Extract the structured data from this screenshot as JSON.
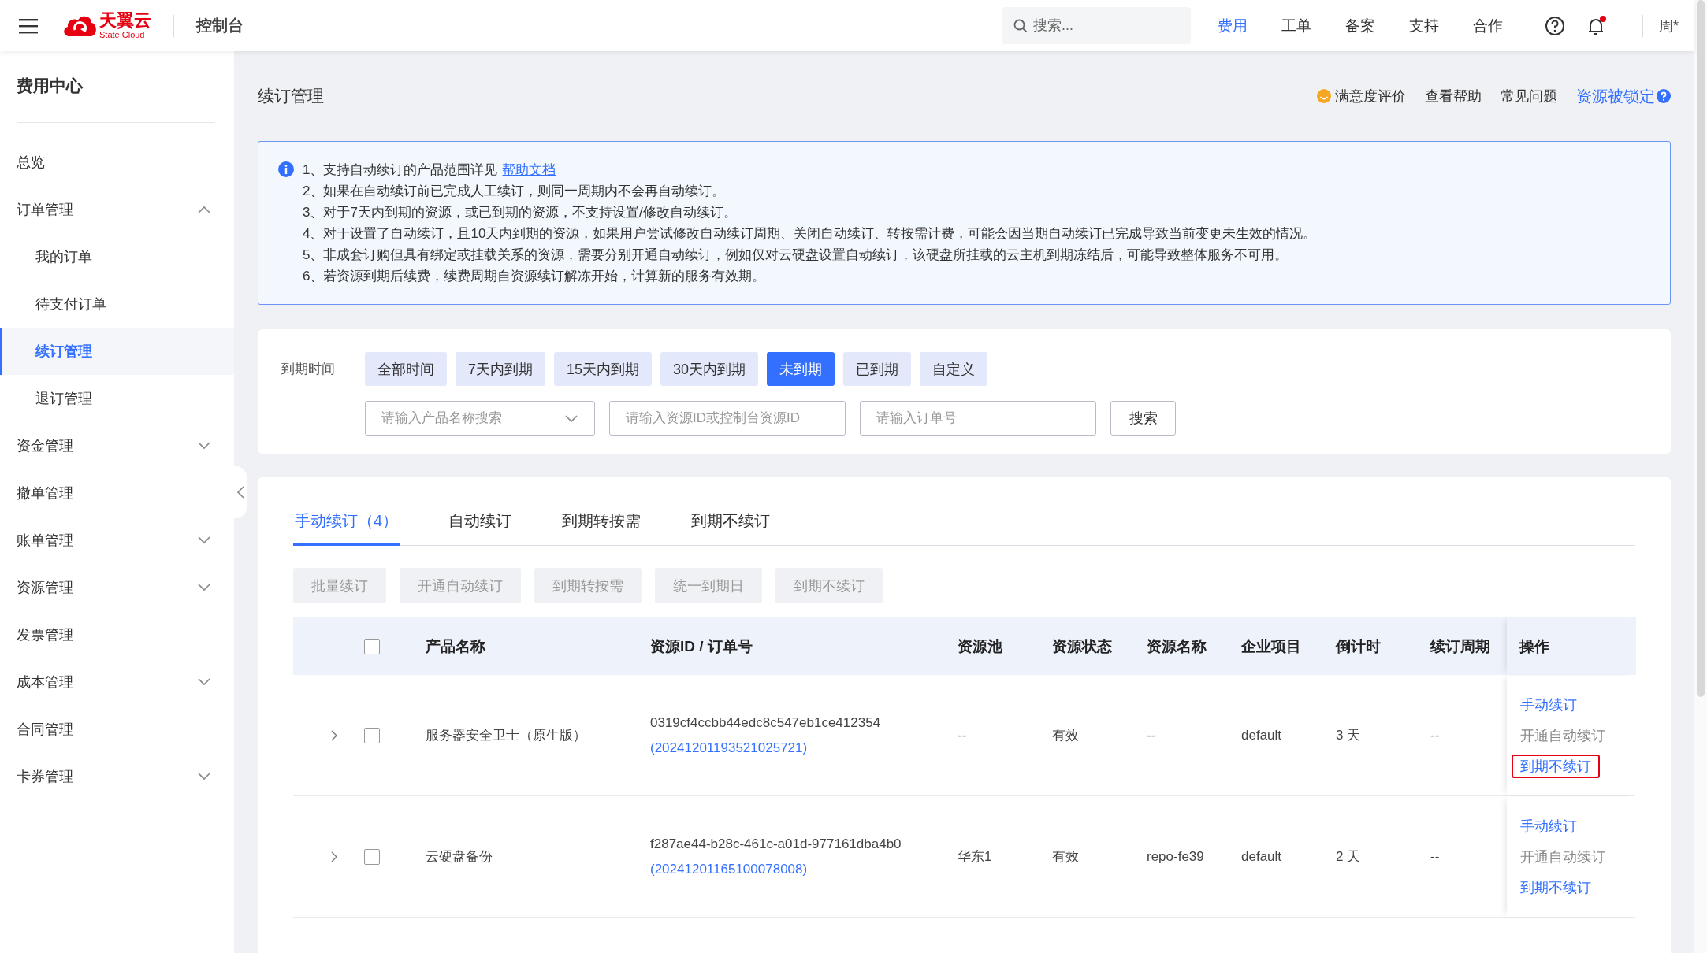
{
  "topbar": {
    "brand": "天翼云",
    "brand_sub": "State Cloud",
    "console": "控制台",
    "search": {
      "placeholder": "搜索..."
    },
    "nav": [
      {
        "label": "费用",
        "selected": true
      },
      {
        "label": "工单",
        "selected": false
      },
      {
        "label": "备案",
        "selected": false
      },
      {
        "label": "支持",
        "selected": false
      },
      {
        "label": "合作",
        "selected": false
      }
    ],
    "notification_dot": true,
    "user": "周*"
  },
  "sidebar": {
    "title": "费用中心",
    "items": [
      {
        "label": "总览",
        "kind": "link",
        "selected": false
      },
      {
        "label": "订单管理",
        "kind": "group",
        "selected": false,
        "expanded": true,
        "children": [
          {
            "label": "我的订单",
            "selected": false
          },
          {
            "label": "待支付订单",
            "selected": false
          },
          {
            "label": "续订管理",
            "selected": true
          },
          {
            "label": "退订管理",
            "selected": false
          }
        ]
      },
      {
        "label": "资金管理",
        "kind": "group",
        "selected": false,
        "expanded": false
      },
      {
        "label": "撤单管理",
        "kind": "link",
        "selected": false
      },
      {
        "label": "账单管理",
        "kind": "group",
        "selected": false,
        "expanded": false
      },
      {
        "label": "资源管理",
        "kind": "group",
        "selected": false,
        "expanded": false
      },
      {
        "label": "发票管理",
        "kind": "link",
        "selected": false
      },
      {
        "label": "成本管理",
        "kind": "group",
        "selected": false,
        "expanded": false
      },
      {
        "label": "合同管理",
        "kind": "link",
        "selected": false
      },
      {
        "label": "卡券管理",
        "kind": "group",
        "selected": false,
        "expanded": false
      }
    ]
  },
  "page": {
    "title": "续订管理",
    "links": [
      {
        "label": "满意度评价",
        "kind": "rating"
      },
      {
        "label": "查看帮助",
        "kind": "plain"
      },
      {
        "label": "常见问题",
        "kind": "plain"
      },
      {
        "label": "资源被锁定",
        "kind": "locked"
      }
    ]
  },
  "notice": [
    {
      "text": "1、支持自动续订的产品范围详见",
      "link": "帮助文档"
    },
    {
      "text": "2、如果在自动续订前已完成人工续订，则同一周期内不会再自动续订。"
    },
    {
      "text": "3、对于7天内到期的资源，或已到期的资源，不支持设置/修改自动续订。"
    },
    {
      "text": "4、对于设置了自动续订，且10天内到期的资源，如果用户尝试修改自动续订周期、关闭自动续订、转按需计费，可能会因当期自动续订已完成导致当前变更未生效的情况。"
    },
    {
      "text": "5、非成套订购但具有绑定或挂载关系的资源，需要分别开通自动续订，例如仅对云硬盘设置自动续订，该硬盘所挂载的云主机到期冻结后，可能导致整体服务不可用。"
    },
    {
      "text": "6、若资源到期后续费，续费周期自资源续订解冻开始，计算新的服务有效期。"
    }
  ],
  "filters": {
    "label": "到期时间",
    "chips": [
      {
        "label": "全部时间",
        "selected": false
      },
      {
        "label": "7天内到期",
        "selected": false
      },
      {
        "label": "15天内到期",
        "selected": false
      },
      {
        "label": "30天内到期",
        "selected": false
      },
      {
        "label": "未到期",
        "selected": true
      },
      {
        "label": "已到期",
        "selected": false
      },
      {
        "label": "自定义",
        "selected": false
      }
    ],
    "product_select": {
      "placeholder": "请输入产品名称搜索"
    },
    "resource_field": {
      "placeholder": "请输入资源ID或控制台资源ID"
    },
    "order_field": {
      "placeholder": "请输入订单号"
    },
    "search_button": "搜索"
  },
  "tabs": [
    {
      "label": "手动续订（4）",
      "selected": true
    },
    {
      "label": "自动续订",
      "selected": false
    },
    {
      "label": "到期转按需",
      "selected": false
    },
    {
      "label": "到期不续订",
      "selected": false
    }
  ],
  "bulk_actions": [
    {
      "label": "批量续订",
      "disabled": true
    },
    {
      "label": "开通自动续订",
      "disabled": true
    },
    {
      "label": "到期转按需",
      "disabled": true
    },
    {
      "label": "统一到期日",
      "disabled": true
    },
    {
      "label": "到期不续订",
      "disabled": true
    }
  ],
  "table": {
    "select_all_checked": false,
    "columns": [
      "产品名称",
      "资源ID / 订单号",
      "资源池",
      "资源状态",
      "资源名称",
      "企业项目",
      "倒计时",
      "续订周期",
      "操作"
    ],
    "rows": [
      {
        "expanded": false,
        "checked": false,
        "product": "服务器安全卫士（原生版）",
        "resource_id": "0319cf4ccbb44edc8c547eb1ce412354",
        "order_no": "(20241201193521025721)",
        "pool": "--",
        "status": "有效",
        "resource_name": "--",
        "project": "default",
        "countdown": "3 天",
        "period": "--",
        "actions": [
          {
            "label": "手动续订",
            "disabled": false,
            "highlighted": false
          },
          {
            "label": "开通自动续订",
            "disabled": true,
            "highlighted": false
          },
          {
            "label": "到期不续订",
            "disabled": false,
            "highlighted": true
          }
        ]
      },
      {
        "expanded": false,
        "checked": false,
        "product": "云硬盘备份",
        "resource_id": "f287ae44-b28c-461c-a01d-977161dba4b0",
        "order_no": "(20241201165100078008)",
        "pool": "华东1",
        "status": "有效",
        "resource_name": "repo-fe39",
        "project": "default",
        "countdown": "2 天",
        "period": "--",
        "actions": [
          {
            "label": "手动续订",
            "disabled": false,
            "highlighted": false
          },
          {
            "label": "开通自动续订",
            "disabled": true,
            "highlighted": false
          },
          {
            "label": "到期不续订",
            "disabled": false,
            "highlighted": false
          }
        ]
      }
    ]
  }
}
